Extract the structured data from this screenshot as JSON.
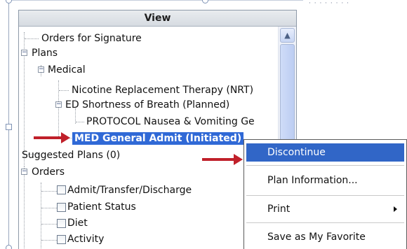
{
  "corner_text": "· · ·  · ·   · · ·",
  "panel": {
    "title": "View"
  },
  "tree": {
    "orders_for_signature": "Orders for Signature",
    "plans": "Plans",
    "medical": "Medical",
    "nicotine": "Nicotine Replacement Therapy (NRT)",
    "ed_sob": "ED Shortness of Breath (Planned)",
    "protocol": "PROTOCOL Nausea & Vomiting Ge",
    "med_general": "MED General Admit (Initiated)",
    "suggested_plans": "Suggested Plans (0)",
    "orders": "Orders",
    "admit_transfer": "Admit/Transfer/Discharge",
    "patient_status": "Patient Status",
    "diet": "Diet",
    "activity": "Activity"
  },
  "context_menu": {
    "items": [
      {
        "label": "Discontinue"
      },
      {
        "label": "Plan Information..."
      },
      {
        "label": "Print"
      },
      {
        "label": "Save as My Favorite"
      }
    ]
  },
  "colors": {
    "selection": "#3069d6",
    "menu_highlight": "#3166c7",
    "arrow": "#c0202a"
  },
  "icons": {
    "expander": "minus-box-icon",
    "scroll_up": "chevron-up-icon",
    "submenu": "triangle-right-icon",
    "arrow": "red-pointer-arrow-icon"
  }
}
